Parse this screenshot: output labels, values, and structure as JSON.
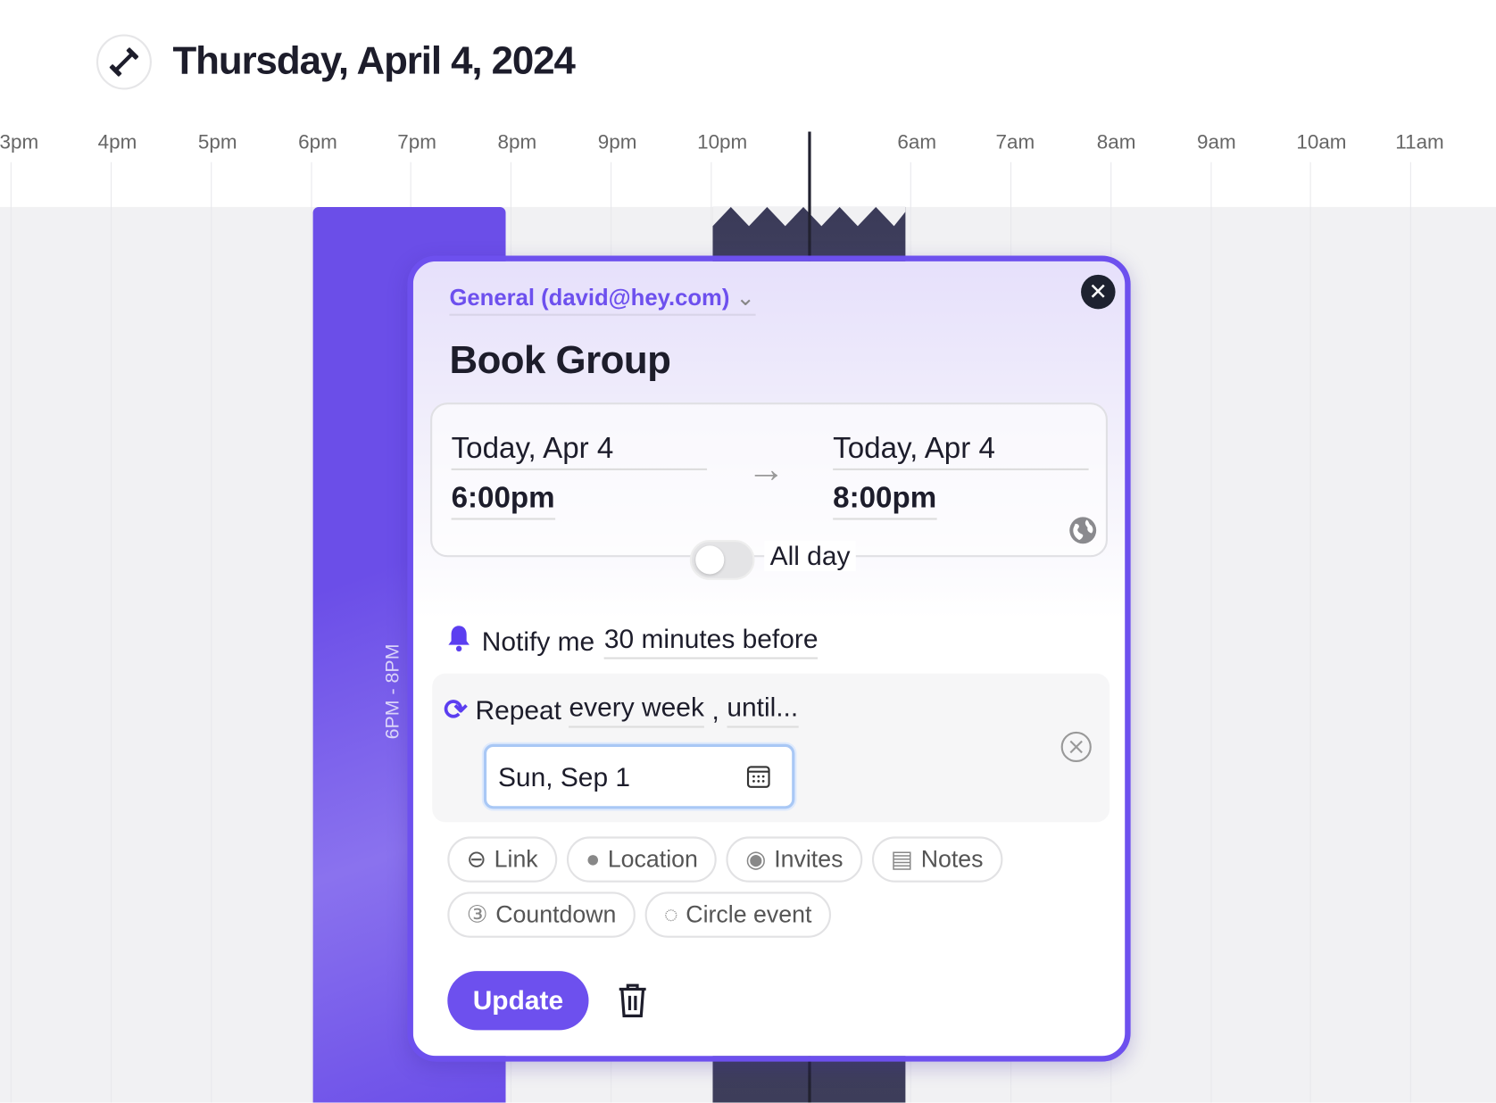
{
  "header": {
    "title": "Thursday, April 4, 2024",
    "icon": "dumbbell-icon"
  },
  "timeline": {
    "hours": [
      "3pm",
      "4pm",
      "5pm",
      "6pm",
      "7pm",
      "8pm",
      "9pm",
      "10pm",
      "6am",
      "7am",
      "8am",
      "9am",
      "10am",
      "11am"
    ]
  },
  "event_block": {
    "label": "6PM - 8PM",
    "color": "#6d50ee"
  },
  "popup": {
    "calendar": "General (david@hey.com)",
    "title": "Book Group",
    "start": {
      "date": "Today, Apr 4",
      "time": "6:00pm"
    },
    "end": {
      "date": "Today, Apr 4",
      "time": "8:00pm"
    },
    "all_day_label": "All day",
    "all_day": false,
    "notify": {
      "prefix": "Notify me",
      "value": "30 minutes before"
    },
    "repeat": {
      "prefix": "Repeat",
      "value": "every week",
      "sep": ",",
      "until": "until...",
      "until_date": "Sun, Sep 1"
    },
    "chips": [
      "Link",
      "Location",
      "Invites",
      "Notes",
      "Countdown",
      "Circle event"
    ],
    "update_label": "Update"
  }
}
